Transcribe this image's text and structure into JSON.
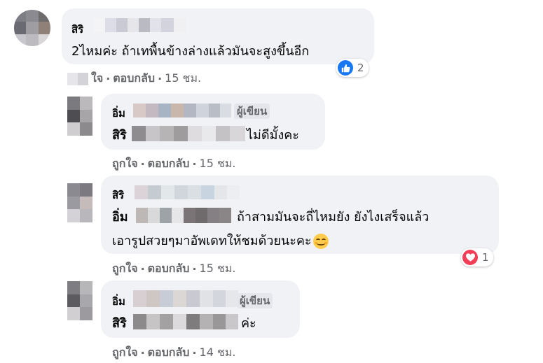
{
  "comments": [
    {
      "name": "สิริ",
      "text": "2ไหมค่ะ ถ้าเทพื้นข้างล่างแล้วมันจะสูงขึ้นอีก",
      "actions": {
        "like": "ใจ",
        "reply": "ตอบกลับ",
        "time": "15 ชม."
      },
      "reaction": {
        "icon": "like-icon",
        "count": "2",
        "color": "#1877f2"
      }
    }
  ],
  "replies": [
    {
      "name": "อิ่ม",
      "badge": "ผู้เขียน",
      "mention": "สิริ",
      "text": "ไม่ดีมั้งคะ",
      "actions": {
        "like": "ถูกใจ",
        "reply": "ตอบกลับ",
        "time": "15 ชม."
      }
    },
    {
      "name": "สิริ",
      "mention": "อิ่ม",
      "line1": "ถ้าสามมันจะถี่ไหมยัง ยังไงเสร็จแล้ว",
      "line2": "เอารูปสวยๆมาอัพเดทให้ชมด้วยนะคะ",
      "emoji": "smiling-face-icon",
      "actions": {
        "like": "ถูกใจ",
        "reply": "ตอบกลับ",
        "time": "15 ชม."
      },
      "reaction": {
        "icon": "love-icon",
        "count": "1",
        "color": "#f33e58"
      }
    },
    {
      "name": "อิ่ม",
      "badge": "ผู้เขียน",
      "mention": "สิริ",
      "text": "ค่ะ",
      "actions": {
        "like": "ถูกใจ",
        "reply": "ตอบกลับ",
        "time": "14 ชม."
      }
    }
  ],
  "separator": "·"
}
